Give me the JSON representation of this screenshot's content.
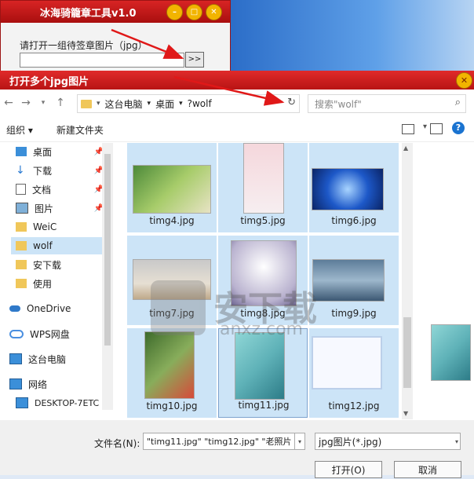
{
  "bg_window": {
    "title": "冰海骑籠章工具v1.0",
    "prompt": "请打开一组待签章图片（jpg）",
    "browse_label": ">>"
  },
  "dialog": {
    "title": "打开多个jpg图片",
    "close_label": "✕",
    "breadcrumb": [
      "这台电脑",
      "桌面",
      "?wolf"
    ],
    "search_placeholder": "搜索\"wolf\"",
    "organize_label": "组织 ▾",
    "new_folder_label": "新建文件夹",
    "help_label": "?"
  },
  "sidebar": {
    "items": [
      {
        "label": "桌面",
        "pinned": true
      },
      {
        "label": "下载",
        "pinned": true
      },
      {
        "label": "文档",
        "pinned": true
      },
      {
        "label": "图片",
        "pinned": true
      },
      {
        "label": "WeiC",
        "pinned": false
      },
      {
        "label": "wolf",
        "pinned": false,
        "selected": true
      },
      {
        "label": "安下载",
        "pinned": false
      },
      {
        "label": "使用",
        "pinned": false
      },
      {
        "label": "OneDrive",
        "pinned": false
      },
      {
        "label": "WPS网盘",
        "pinned": false
      },
      {
        "label": "这台电脑",
        "pinned": false
      },
      {
        "label": "网络",
        "pinned": false
      },
      {
        "label": "DESKTOP-7ETC",
        "pinned": false
      }
    ]
  },
  "files": [
    {
      "name": "timg4.jpg",
      "selected": true
    },
    {
      "name": "timg5.jpg",
      "selected": true
    },
    {
      "name": "timg6.jpg",
      "selected": true
    },
    {
      "name": "timg7.jpg",
      "selected": true
    },
    {
      "name": "timg8.jpg",
      "selected": true
    },
    {
      "name": "timg9.jpg",
      "selected": true
    },
    {
      "name": "timg10.jpg",
      "selected": true
    },
    {
      "name": "timg11.jpg",
      "selected": true,
      "focused": true
    },
    {
      "name": "timg12.jpg",
      "selected": true
    }
  ],
  "watermark": {
    "text": "安下载",
    "sub": "anxz.com"
  },
  "footer": {
    "filename_label": "文件名(N):",
    "filename_value": "\"timg11.jpg\" \"timg12.jpg\" \"老照片",
    "filetype_value": "jpg图片(*.jpg)",
    "open_label": "打开(O)",
    "cancel_label": "取消"
  },
  "colors": {
    "title_red": "#c81818",
    "selection_blue": "#cce4f7",
    "accent_blue": "#1a73d0"
  }
}
